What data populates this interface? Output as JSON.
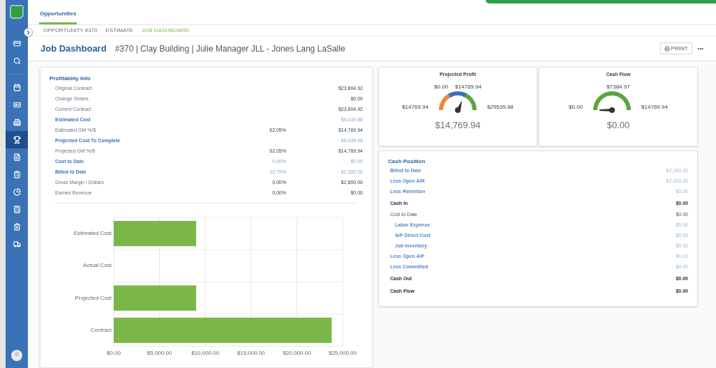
{
  "sidebar": {
    "top_items": [
      {
        "selected": false
      },
      {
        "selected": false
      }
    ],
    "items": [
      {
        "selected": false
      },
      {
        "selected": false
      },
      {
        "selected": false
      },
      {
        "selected": true
      },
      {
        "selected": false
      },
      {
        "selected": false
      },
      {
        "selected": false
      },
      {
        "selected": false
      },
      {
        "selected": false
      },
      {
        "selected": false
      }
    ]
  },
  "header": {
    "tab": "Opportunities",
    "breadcrumbs": [
      {
        "label": "OPPORTUNITY #370",
        "selected": false
      },
      {
        "label": "ESTIMATE",
        "selected": false
      },
      {
        "label": "JOB DASHBOARD",
        "selected": true
      }
    ],
    "title": "Job Dashboard",
    "subtitle": "#370 | Clay Building | Julie Manager JLL - Jones Lang LaSalle",
    "print_button": "PRINT",
    "more_button": "•••"
  },
  "profitability": {
    "title": "Profitablity Info",
    "rows": [
      {
        "label": "Original Contract",
        "kind": "plain",
        "value": "$23,804.92"
      },
      {
        "label": "Change Orders",
        "kind": "plain",
        "value": "$0.00"
      },
      {
        "label": "Current Contract",
        "kind": "plain",
        "value": "$23,804.92"
      },
      {
        "label": "Estimated Cost",
        "kind": "link",
        "value": "$9,034.98"
      },
      {
        "label": "Estimated GM %/$",
        "kind": "plain",
        "percent": "62.05%",
        "value": "$14,769.94"
      },
      {
        "label": "Projected Cost To Complete",
        "kind": "link",
        "value": "$9,034.98"
      },
      {
        "label": "Projected GM %/$",
        "kind": "plain",
        "percent": "62.05%",
        "value": "$14,769.94"
      },
      {
        "label": "Cost to Date",
        "kind": "link",
        "percent": "0.00%",
        "value": "$0.00"
      },
      {
        "label": "Billed to Date",
        "kind": "link",
        "percent": "10.70%",
        "value": "$2,300.00"
      },
      {
        "label": "Gross Margin / Dollars",
        "kind": "plain",
        "percent": "0.00%",
        "value": "$2,800.00"
      },
      {
        "label": "Earned Revenue",
        "kind": "plain",
        "percent": "0.00%",
        "value": "$0.00"
      }
    ],
    "chart_data": {
      "type": "bar",
      "orientation": "horizontal",
      "categories": [
        "Estimated Cost",
        "Actual Cost",
        "Projected Cost",
        "Contract"
      ],
      "series": [
        {
          "color": "#7ab648",
          "values": [
            9000,
            0,
            9000,
            23800
          ]
        }
      ],
      "grid": true,
      "xlim": [
        0,
        25000
      ],
      "xticks": [
        {
          "value": 0,
          "label": "$0.00"
        },
        {
          "value": 5000,
          "label": "$5,000.00"
        },
        {
          "value": 10000,
          "label": "$10,000.00"
        },
        {
          "value": 15000,
          "label": "$15,000.00"
        },
        {
          "value": 20000,
          "label": "$20,000.00"
        },
        {
          "value": 25000,
          "label": "$25,000.00"
        }
      ]
    }
  },
  "gauges": [
    {
      "title": "Projected Profit",
      "kind": "three_band",
      "labels": {
        "left": "$14769.94",
        "top_left": "$0.00",
        "top_right": "$14769.94",
        "right": "$29539.88"
      },
      "value": "$14,769.94"
    },
    {
      "title": "Cash Flow",
      "kind": "single_band",
      "labels": {
        "left": "$0.00",
        "top": "$7384.97",
        "right": "$14769.94"
      },
      "value": "$0.00"
    }
  ],
  "cash_position": {
    "title": "Cash Position",
    "rows": [
      {
        "label": "Billed to Date",
        "kind": "link",
        "value": "$2,300.00"
      },
      {
        "label": "Less Open A/R",
        "kind": "link",
        "value": "$2,300.00"
      },
      {
        "label": "Less Retention",
        "kind": "link",
        "value": "$0.00"
      },
      {
        "label": "Cash In",
        "kind": "total",
        "value": "$0.00"
      },
      {
        "label": "Cost to Date",
        "kind": "plain",
        "value": "$0.00",
        "children": [
          {
            "label": "Labor Expense",
            "kind": "link",
            "value": "$0.00"
          },
          {
            "label": "A/P Direct Cost",
            "kind": "link",
            "value": "$0.00"
          },
          {
            "label": "Job Inventory",
            "kind": "link",
            "value": "$0.00"
          }
        ]
      },
      {
        "label": "Less Open A/P",
        "kind": "link",
        "value": "$0.00"
      },
      {
        "label": "Less Committed",
        "kind": "link",
        "value": "$0.00"
      },
      {
        "label": "Cash Out",
        "kind": "total",
        "value": "$0.00"
      },
      {
        "label": "Cash Flow",
        "kind": "total",
        "value": "$0.00"
      }
    ]
  }
}
